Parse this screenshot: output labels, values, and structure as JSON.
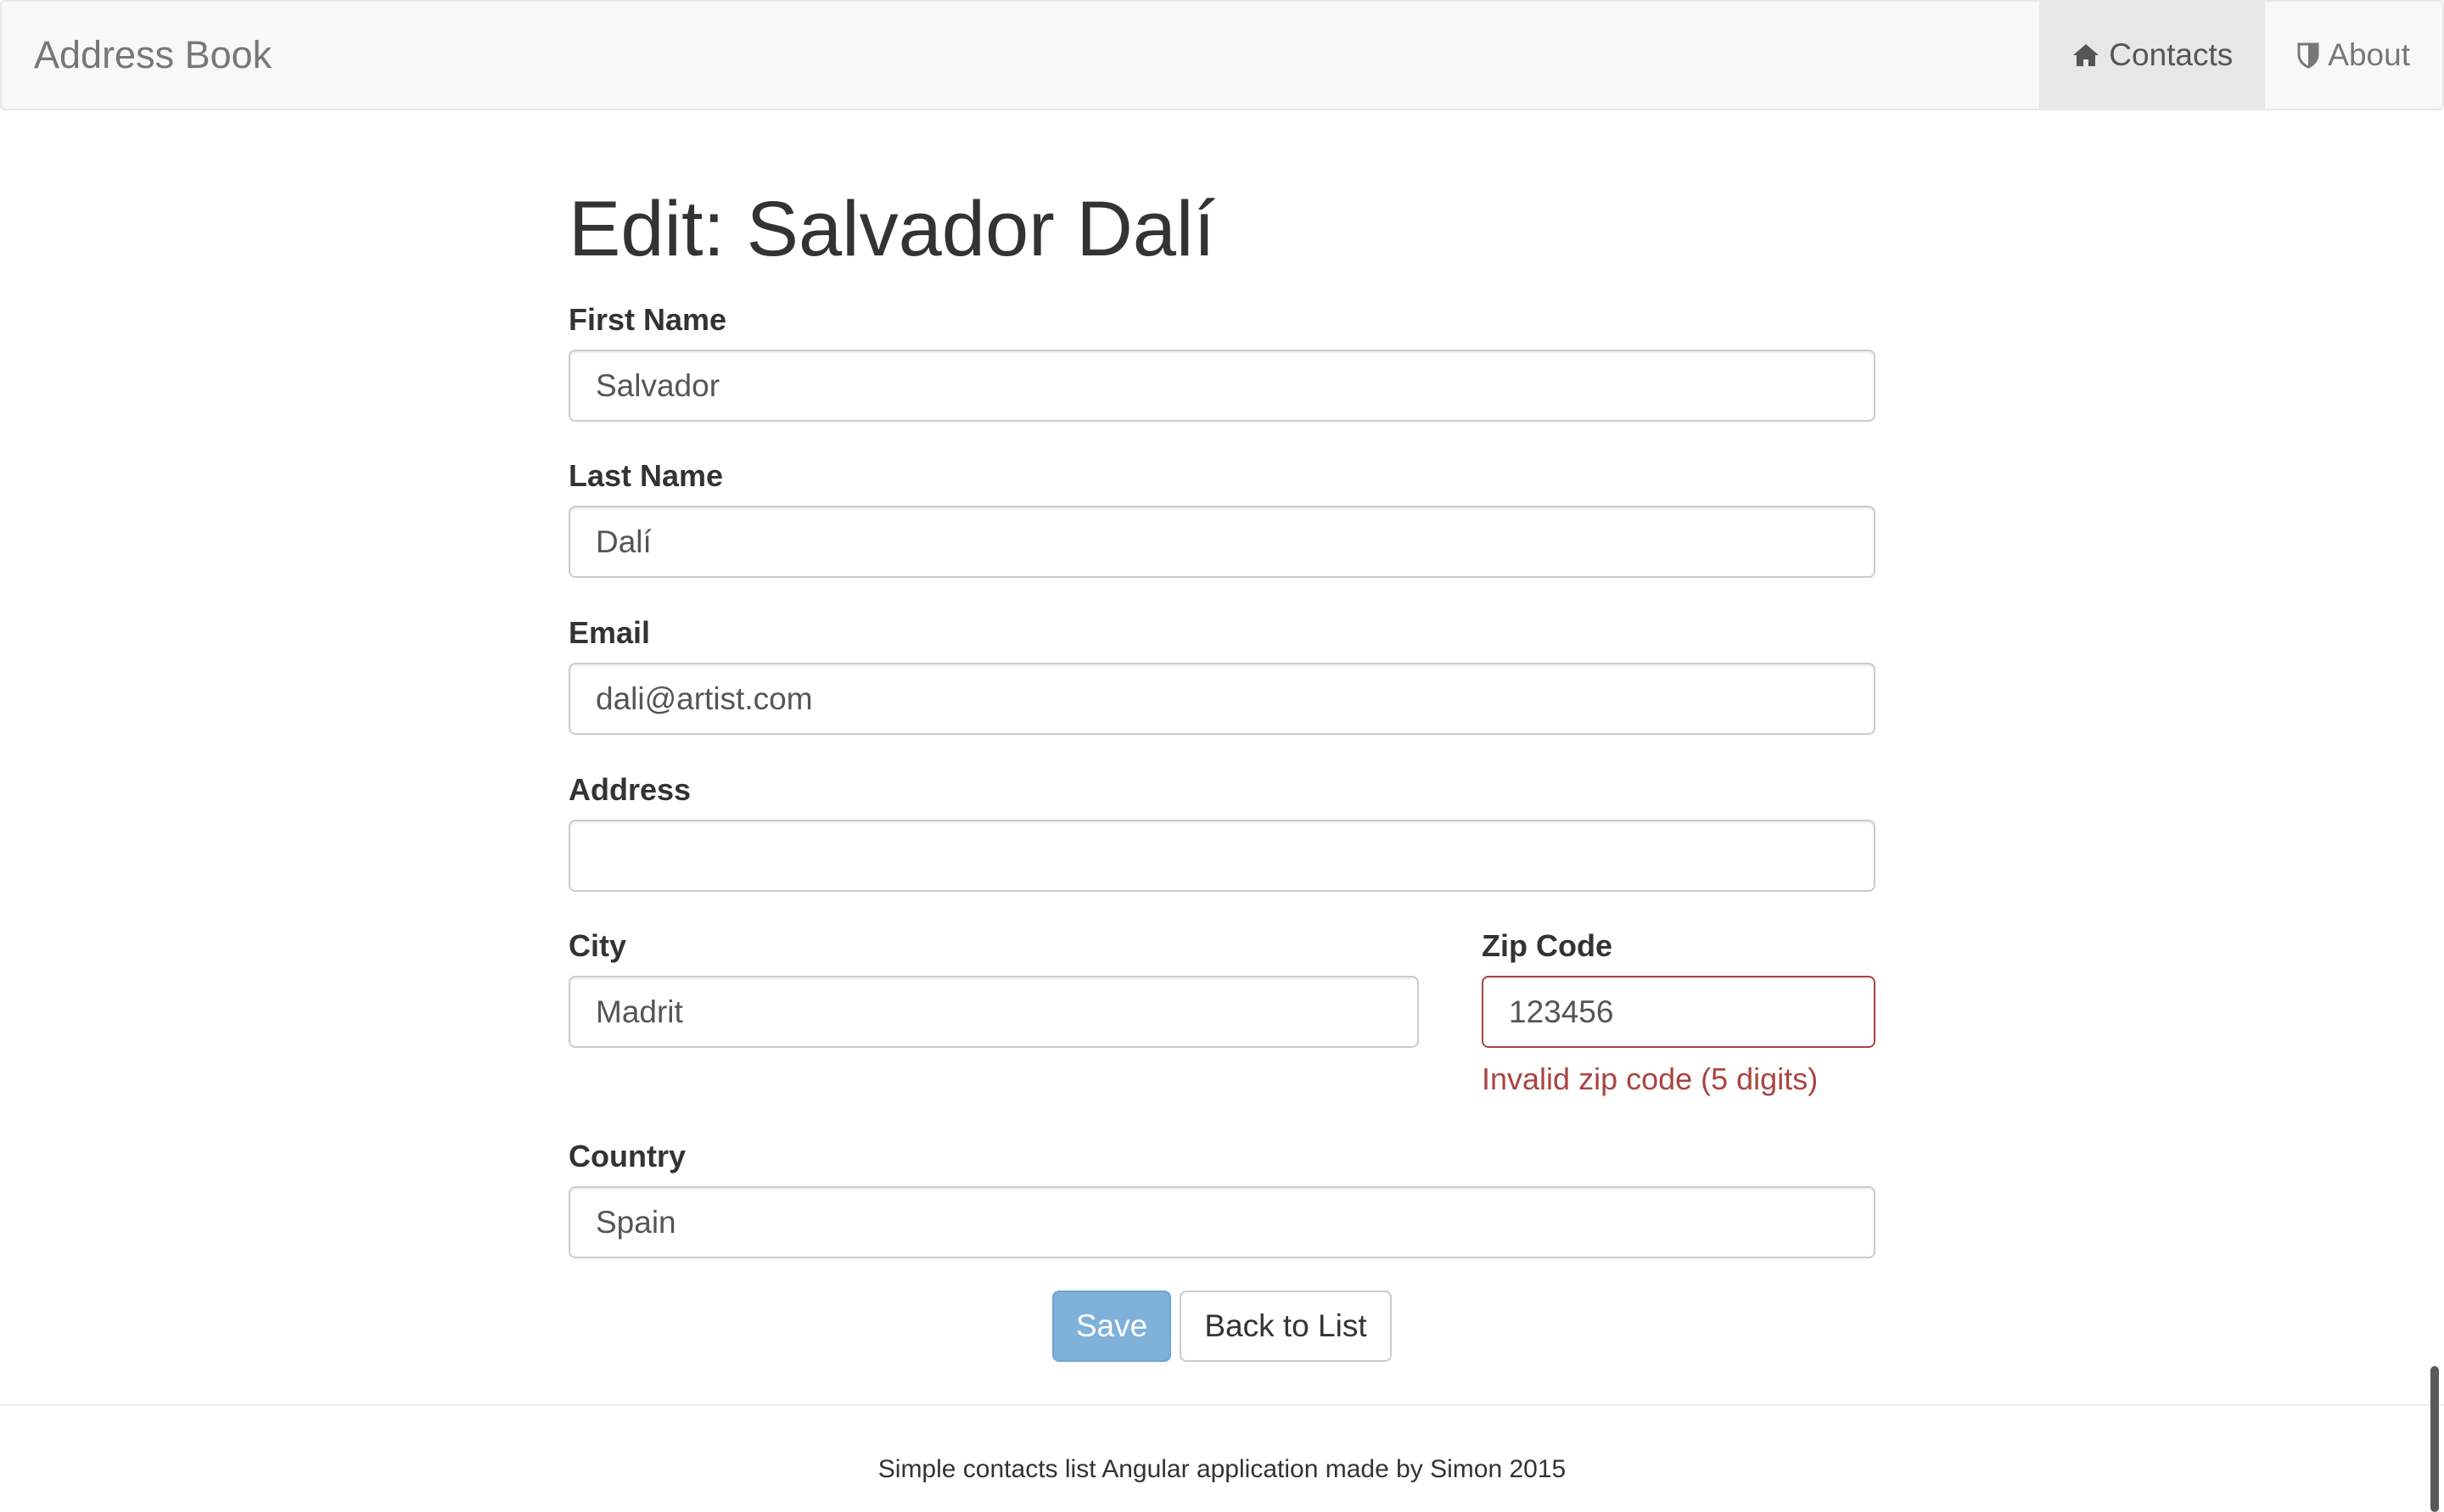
{
  "navbar": {
    "brand": "Address Book",
    "items": [
      {
        "label": "Contacts",
        "icon": "home-icon",
        "active": true
      },
      {
        "label": "About",
        "icon": "shield-icon",
        "active": false
      }
    ]
  },
  "form": {
    "title": "Edit: Salvador Dalí",
    "first_name": {
      "label": "First Name",
      "value": "Salvador"
    },
    "last_name": {
      "label": "Last Name",
      "value": "Dalí"
    },
    "email": {
      "label": "Email",
      "value": "dali@artist.com"
    },
    "address": {
      "label": "Address",
      "value": ""
    },
    "city": {
      "label": "City",
      "value": "Madrit"
    },
    "zip": {
      "label": "Zip Code",
      "value": "123456",
      "error": "Invalid zip code (5 digits)"
    },
    "country": {
      "label": "Country",
      "value": "Spain"
    }
  },
  "buttons": {
    "save": "Save",
    "back": "Back to List"
  },
  "footer": {
    "text": "Simple contacts list Angular application made by Simon 2015"
  },
  "colors": {
    "error": "#a94442",
    "primary_disabled": "#7fb1db",
    "navbar_bg": "#f8f8f8"
  }
}
